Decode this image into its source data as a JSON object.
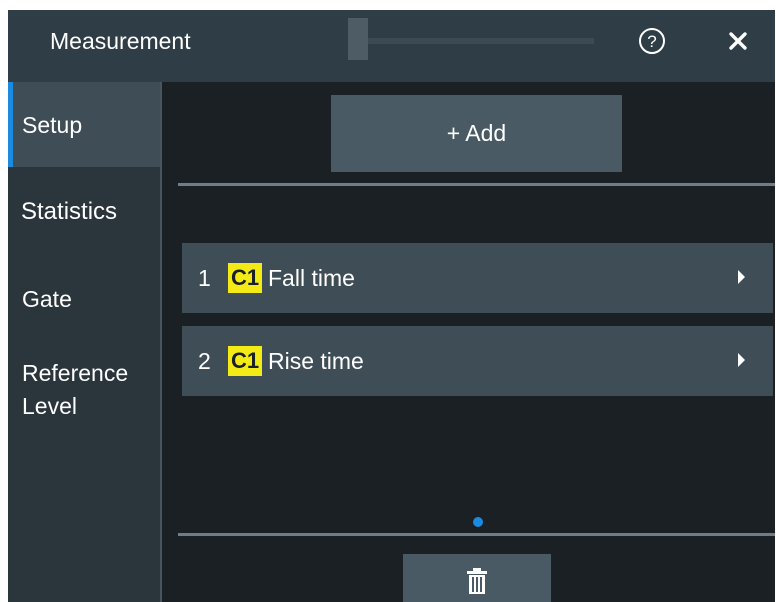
{
  "dialog": {
    "title": "Measurement",
    "icons": {
      "help": "help-circle-icon",
      "close": "close-icon"
    }
  },
  "sidebar": {
    "items": [
      {
        "label": "Setup",
        "active": true
      },
      {
        "label": "Statistics",
        "active": false
      },
      {
        "label": "Gate",
        "active": false
      },
      {
        "label": "Reference\nLevel",
        "active": false
      }
    ]
  },
  "main": {
    "add_button_label": "+ Add",
    "measurements": [
      {
        "number": "1",
        "channel": "C1",
        "name": "Fall time"
      },
      {
        "number": "2",
        "channel": "C1",
        "name": "Rise time"
      }
    ],
    "delete_icon": "trash-icon"
  },
  "colors": {
    "accent": "#1b8be0",
    "channel_badge": "#f4eb16",
    "background": "#1a2024",
    "panel": "#3f4d56"
  }
}
